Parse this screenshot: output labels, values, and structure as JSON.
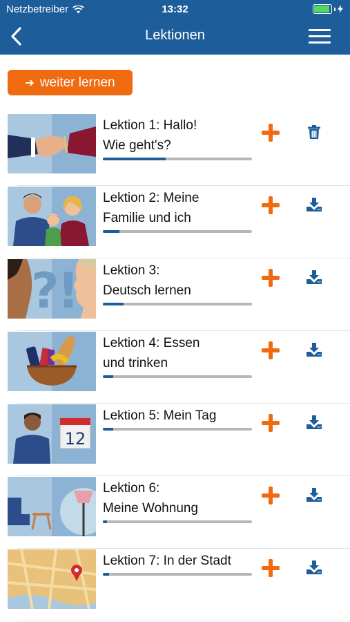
{
  "status_bar": {
    "carrier": "Netzbetreiber",
    "time": "13:32"
  },
  "nav": {
    "title": "Lektionen"
  },
  "continue_button": {
    "label": "weiter lernen"
  },
  "colors": {
    "brand_blue": "#1d5d99",
    "accent_orange": "#f06a10"
  },
  "lessons": [
    {
      "title": "Lektion 1: Hallo!\nWie geht's?",
      "progress": 0.42,
      "action_icon": "trash-icon"
    },
    {
      "title": "Lektion 2: Meine\nFamilie und ich",
      "progress": 0.11,
      "action_icon": "download-icon"
    },
    {
      "title": "Lektion 3:\nDeutsch lernen",
      "progress": 0.14,
      "action_icon": "download-icon"
    },
    {
      "title": "Lektion 4: Essen\nund trinken",
      "progress": 0.07,
      "action_icon": "download-icon"
    },
    {
      "title": "Lektion 5: Mein Tag",
      "progress": 0.07,
      "action_icon": "download-icon",
      "calendar_day": "12"
    },
    {
      "title": "Lektion 6:\nMeine Wohnung",
      "progress": 0.03,
      "action_icon": "download-icon"
    },
    {
      "title": "Lektion 7: In der Stadt",
      "progress": 0.04,
      "action_icon": "download-icon"
    }
  ]
}
